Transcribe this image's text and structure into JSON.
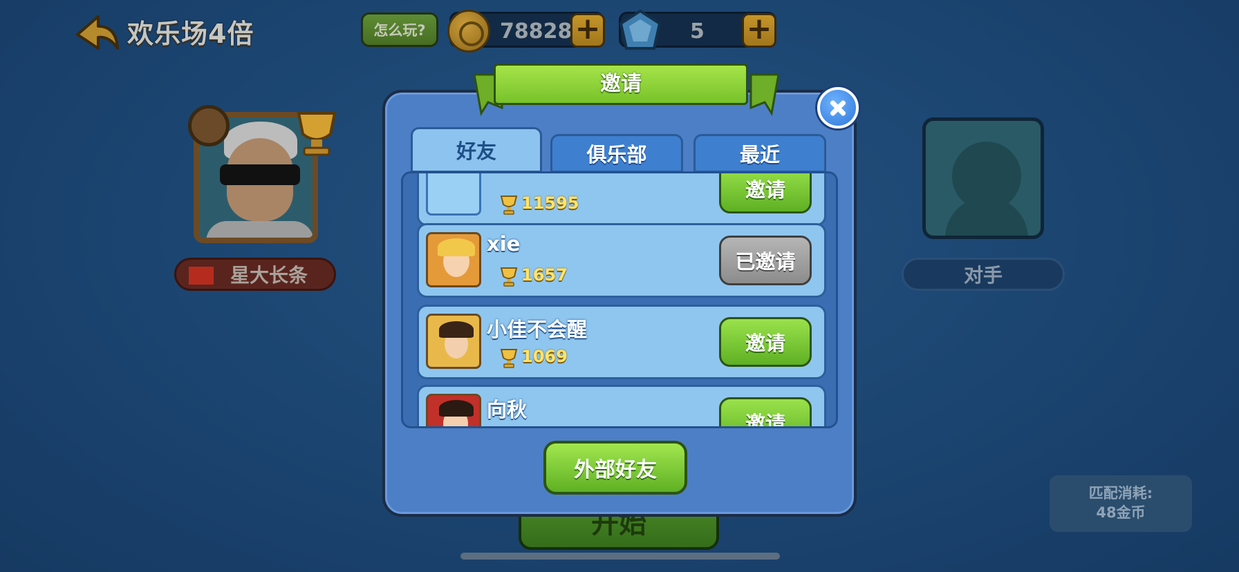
{
  "header": {
    "title": "欢乐场4倍",
    "howto_label": "怎么玩?",
    "coins": "78828",
    "gems": "5",
    "plus_symbol": "+"
  },
  "players": {
    "me": {
      "name": "星大长条"
    },
    "opponent": {
      "name": "对手"
    }
  },
  "start_label": "开始",
  "match_cost": {
    "line1": "匹配消耗:",
    "line2": "48金币"
  },
  "invite_dialog": {
    "title": "邀请",
    "tabs": [
      {
        "label": "好友",
        "active": true
      },
      {
        "label": "俱乐部",
        "active": false
      },
      {
        "label": "最近",
        "active": false
      }
    ],
    "friends": [
      {
        "name": "",
        "score": "11595",
        "action": "邀请",
        "invited": false
      },
      {
        "name": "xie",
        "score": "1657",
        "action": "已邀请",
        "invited": true
      },
      {
        "name": "小佳不会醒",
        "score": "1069",
        "action": "邀请",
        "invited": false
      },
      {
        "name": "向秋",
        "score": "",
        "action": "邀请",
        "invited": false
      }
    ],
    "external_label": "外部好友"
  },
  "colors": {
    "accent_green": "#78c22a",
    "dialog_blue": "#4d7fc7",
    "score_gold": "#ffe46a"
  }
}
